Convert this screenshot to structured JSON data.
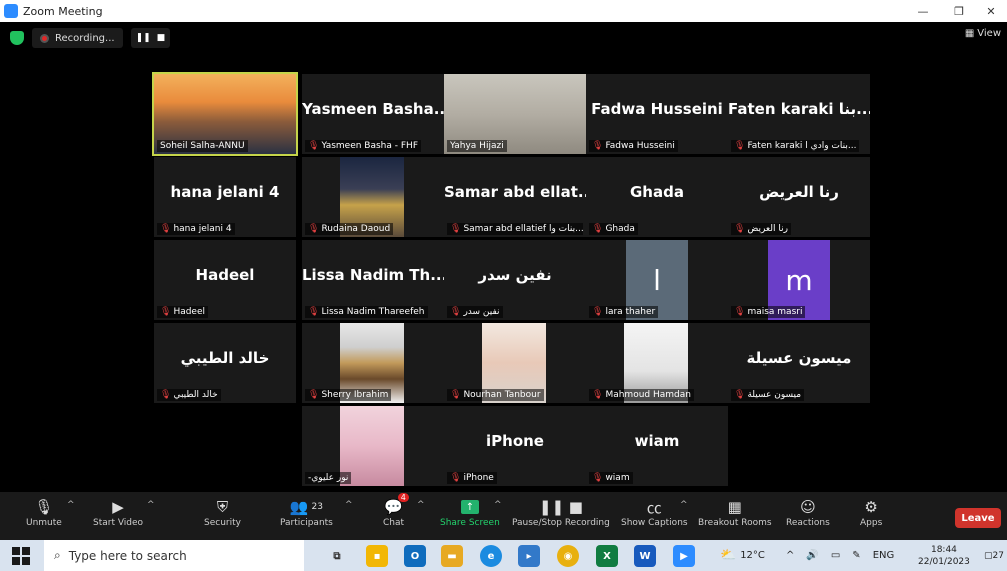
{
  "window": {
    "title": "Zoom Meeting"
  },
  "recording": {
    "label": "Recording..."
  },
  "view": {
    "label": "View"
  },
  "tiles": [
    {
      "name": "",
      "label": "Soheil Salha-ANNU",
      "muted": false,
      "video": "sunset"
    },
    {
      "name": "Yasmeen Basha...",
      "label": "Yasmeen Basha - FHF",
      "muted": true
    },
    {
      "name": "",
      "label": "Yahya Hijazi",
      "muted": false,
      "video": "man"
    },
    {
      "name": "Fadwa Husseini",
      "label": "Fadwa Husseini",
      "muted": true
    },
    {
      "name": "Faten karaki بنا...",
      "label": "Faten karaki بنات وادي ا...",
      "muted": true
    },
    {
      "name": "hana jelani 4",
      "label": "hana jelani 4",
      "muted": true
    },
    {
      "name": "",
      "label": "Rudaina Daoud",
      "muted": true,
      "video": "dome"
    },
    {
      "name": "Samar abd ellat...",
      "label": "Samar abd ellatief بنات وا...",
      "muted": true
    },
    {
      "name": "Ghada",
      "label": "Ghada",
      "muted": true
    },
    {
      "name": "رنا العريض",
      "label": "رنا العريض",
      "muted": true
    },
    {
      "name": "Hadeel",
      "label": "Hadeel",
      "muted": true
    },
    {
      "name": "Lissa Nadim Th...",
      "label": "Lissa Nadim Thareefeh",
      "muted": true
    },
    {
      "name": "نفين سدر",
      "label": "نفين سدر",
      "muted": true
    },
    {
      "name": "",
      "label": "lara thaher",
      "muted": true,
      "avatar": "l",
      "avatar_color": "#5b6a78"
    },
    {
      "name": "",
      "label": "maisa masri",
      "muted": true,
      "avatar": "m",
      "avatar_color": "#6a3ec8"
    },
    {
      "name": "خالد الطيبي",
      "label": "خالد الطيبي",
      "muted": true
    },
    {
      "name": "",
      "label": "Sherry Ibrahim",
      "muted": true,
      "video": "city"
    },
    {
      "name": "",
      "label": "Nourhan Tanbour",
      "muted": true,
      "video": "girl"
    },
    {
      "name": "",
      "label": "Mahmoud Hamdan",
      "muted": true,
      "video": "poster"
    },
    {
      "name": "ميسون عسيلة",
      "label": "ميسون عسيلة",
      "muted": true
    },
    {
      "name": "",
      "label": "-نور عليوي",
      "muted": false,
      "video": "hijab"
    },
    {
      "name": "iPhone",
      "label": "iPhone",
      "muted": true
    },
    {
      "name": "wiam",
      "label": "wiam",
      "muted": true
    }
  ],
  "toolbar": {
    "unmute": "Unmute",
    "start_video": "Start Video",
    "security": "Security",
    "participants": "Participants",
    "participants_count": "23",
    "chat": "Chat",
    "chat_badge": "4",
    "share_screen": "Share Screen",
    "pause_recording": "Pause/Stop Recording",
    "show_captions": "Show Captions",
    "breakout_rooms": "Breakout Rooms",
    "reactions": "Reactions",
    "apps": "Apps",
    "leave": "Leave"
  },
  "taskbar": {
    "search_placeholder": "Type here to search",
    "weather": "12°C",
    "lang": "ENG",
    "time": "18:44",
    "date": "22/01/2023",
    "notif_count": "27"
  },
  "colors": {
    "accent": "#2d8cff",
    "leave": "#d0342c",
    "share": "#23b26d",
    "active_speaker": "#c5d44a"
  }
}
